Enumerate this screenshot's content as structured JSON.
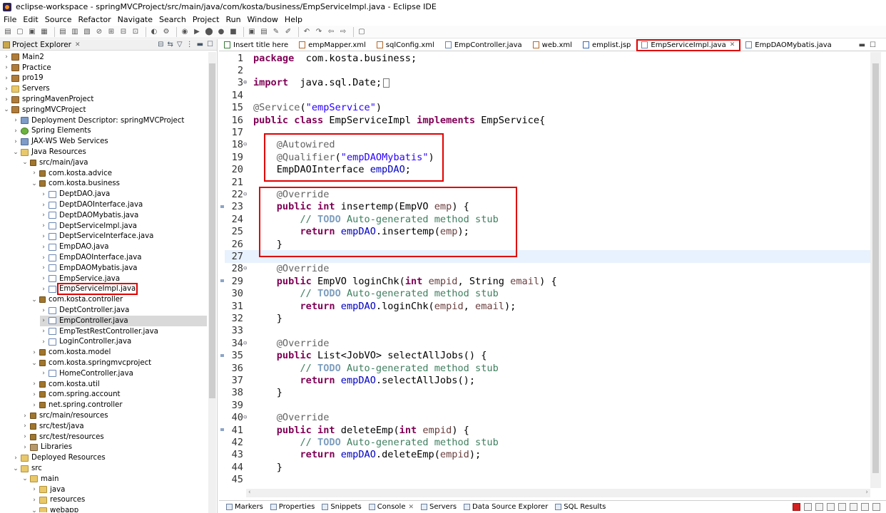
{
  "window": {
    "title": "eclipse-workspace - springMVCProject/src/main/java/com/kosta/business/EmpServiceImpl.java - Eclipse IDE"
  },
  "menu": [
    "File",
    "Edit",
    "Source",
    "Refactor",
    "Navigate",
    "Search",
    "Project",
    "Run",
    "Window",
    "Help"
  ],
  "project_explorer": {
    "title": "Project Explorer",
    "items": [
      {
        "label": "Main2",
        "depth": 0,
        "chevron": ">",
        "icon": "project"
      },
      {
        "label": "Practice",
        "depth": 0,
        "chevron": ">",
        "icon": "project"
      },
      {
        "label": "pro19",
        "depth": 0,
        "chevron": ">",
        "icon": "project"
      },
      {
        "label": "Servers",
        "depth": 0,
        "chevron": ">",
        "icon": "folder"
      },
      {
        "label": "springMavenProject",
        "depth": 0,
        "chevron": ">",
        "icon": "project"
      },
      {
        "label": "springMVCProject",
        "depth": 0,
        "chevron": "v",
        "icon": "project"
      },
      {
        "label": "Deployment Descriptor: springMVCProject",
        "depth": 1,
        "chevron": ">",
        "icon": "descriptor"
      },
      {
        "label": "Spring Elements",
        "depth": 1,
        "chevron": ">",
        "icon": "spring"
      },
      {
        "label": "JAX-WS Web Services",
        "depth": 1,
        "chevron": ">",
        "icon": "descriptor"
      },
      {
        "label": "Java Resources",
        "depth": 1,
        "chevron": "v",
        "icon": "folder"
      },
      {
        "label": "src/main/java",
        "depth": 2,
        "chevron": "v",
        "icon": "package"
      },
      {
        "label": "com.kosta.advice",
        "depth": 3,
        "chevron": ">",
        "icon": "package"
      },
      {
        "label": "com.kosta.business",
        "depth": 3,
        "chevron": "v",
        "icon": "package"
      },
      {
        "label": "DeptDAO.java",
        "depth": 4,
        "chevron": ">",
        "icon": "java"
      },
      {
        "label": "DeptDAOInterface.java",
        "depth": 4,
        "chevron": ">",
        "icon": "java"
      },
      {
        "label": "DeptDAOMybatis.java",
        "depth": 4,
        "chevron": ">",
        "icon": "java"
      },
      {
        "label": "DeptServiceImpl.java",
        "depth": 4,
        "chevron": ">",
        "icon": "java"
      },
      {
        "label": "DeptServiceInterface.java",
        "depth": 4,
        "chevron": ">",
        "icon": "java"
      },
      {
        "label": "EmpDAO.java",
        "depth": 4,
        "chevron": ">",
        "icon": "java"
      },
      {
        "label": "EmpDAOInterface.java",
        "depth": 4,
        "chevron": ">",
        "icon": "java"
      },
      {
        "label": "EmpDAOMybatis.java",
        "depth": 4,
        "chevron": ">",
        "icon": "java"
      },
      {
        "label": "EmpService.java",
        "depth": 4,
        "chevron": ">",
        "icon": "java"
      },
      {
        "label": "EmpServiceImpl.java",
        "depth": 4,
        "chevron": ">",
        "icon": "java",
        "boxed": true
      },
      {
        "label": "com.kosta.controller",
        "depth": 3,
        "chevron": "v",
        "icon": "package"
      },
      {
        "label": "DeptController.java",
        "depth": 4,
        "chevron": ">",
        "icon": "java"
      },
      {
        "label": "EmpController.java",
        "depth": 4,
        "chevron": ">",
        "icon": "java",
        "selected": true
      },
      {
        "label": "EmpTestRestController.java",
        "depth": 4,
        "chevron": ">",
        "icon": "java"
      },
      {
        "label": "LoginController.java",
        "depth": 4,
        "chevron": ">",
        "icon": "java"
      },
      {
        "label": "com.kosta.model",
        "depth": 3,
        "chevron": ">",
        "icon": "package"
      },
      {
        "label": "com.kosta.springmvcproject",
        "depth": 3,
        "chevron": "v",
        "icon": "package"
      },
      {
        "label": "HomeController.java",
        "depth": 4,
        "chevron": ">",
        "icon": "java"
      },
      {
        "label": "com.kosta.util",
        "depth": 3,
        "chevron": ">",
        "icon": "package"
      },
      {
        "label": "com.spring.account",
        "depth": 3,
        "chevron": ">",
        "icon": "package"
      },
      {
        "label": "net.spring.controller",
        "depth": 3,
        "chevron": ">",
        "icon": "package"
      },
      {
        "label": "src/main/resources",
        "depth": 2,
        "chevron": ">",
        "icon": "package"
      },
      {
        "label": "src/test/java",
        "depth": 2,
        "chevron": ">",
        "icon": "package"
      },
      {
        "label": "src/test/resources",
        "depth": 2,
        "chevron": ">",
        "icon": "package"
      },
      {
        "label": "Libraries",
        "depth": 2,
        "chevron": ">",
        "icon": "library"
      },
      {
        "label": "Deployed Resources",
        "depth": 1,
        "chevron": ">",
        "icon": "folder"
      },
      {
        "label": "src",
        "depth": 1,
        "chevron": "v",
        "icon": "folder"
      },
      {
        "label": "main",
        "depth": 2,
        "chevron": "v",
        "icon": "folder"
      },
      {
        "label": "java",
        "depth": 3,
        "chevron": ">",
        "icon": "folder"
      },
      {
        "label": "resources",
        "depth": 3,
        "chevron": ">",
        "icon": "folder"
      },
      {
        "label": "webapp",
        "depth": 3,
        "chevron": "v",
        "icon": "folder"
      }
    ]
  },
  "editor_tabs": [
    {
      "label": "Insert title here",
      "icon": "html"
    },
    {
      "label": "empMapper.xml",
      "icon": "xml"
    },
    {
      "label": "sqlConfig.xml",
      "icon": "xml"
    },
    {
      "label": "EmpController.java",
      "icon": "java"
    },
    {
      "label": "web.xml",
      "icon": "xml"
    },
    {
      "label": "emplist.jsp",
      "icon": "jsp"
    },
    {
      "label": "EmpServiceImpl.java",
      "icon": "java",
      "active": true
    },
    {
      "label": "EmpDAOMybatis.java",
      "icon": "java"
    }
  ],
  "code_lines": [
    {
      "n": "1",
      "fold": "",
      "tokens": [
        [
          "kw",
          "package"
        ],
        [
          "",
          "  com.kosta.business;"
        ]
      ]
    },
    {
      "n": "2",
      "fold": "",
      "tokens": []
    },
    {
      "n": "3",
      "fold": "+",
      "tokens": [
        [
          "kw",
          "import"
        ],
        [
          "",
          "  java.sql.Date;"
        ]
      ],
      "collapsed": true
    },
    {
      "n": "14",
      "fold": "",
      "tokens": []
    },
    {
      "n": "15",
      "fold": "",
      "tokens": [
        [
          "ann",
          "@Service"
        ],
        [
          "",
          "("
        ],
        [
          "str",
          "\"empService\""
        ],
        [
          "",
          ")"
        ]
      ]
    },
    {
      "n": "16",
      "fold": "",
      "tokens": [
        [
          "kw",
          "public"
        ],
        [
          "",
          " "
        ],
        [
          "kw",
          "class"
        ],
        [
          "",
          " EmpServiceImpl "
        ],
        [
          "kw",
          "implements"
        ],
        [
          "",
          " EmpService{"
        ]
      ]
    },
    {
      "n": "17",
      "fold": "",
      "tokens": []
    },
    {
      "n": "18",
      "fold": "-",
      "tokens": [
        [
          "",
          "    "
        ],
        [
          "ann",
          "@Autowired"
        ]
      ]
    },
    {
      "n": "19",
      "fold": "",
      "tokens": [
        [
          "",
          "    "
        ],
        [
          "ann",
          "@Qualifier"
        ],
        [
          "",
          "("
        ],
        [
          "str",
          "\"empDAOMybatis\""
        ],
        [
          "",
          ")"
        ]
      ]
    },
    {
      "n": "20",
      "fold": "",
      "tokens": [
        [
          "",
          "    EmpDAOInterface "
        ],
        [
          "fld",
          "empDAO"
        ],
        [
          "",
          ";"
        ]
      ]
    },
    {
      "n": "21",
      "fold": "",
      "tokens": []
    },
    {
      "n": "22",
      "fold": "-",
      "tokens": [
        [
          "",
          "    "
        ],
        [
          "ann",
          "@Override"
        ]
      ]
    },
    {
      "n": "23",
      "fold": "",
      "tokens": [
        [
          "",
          "    "
        ],
        [
          "kw",
          "public"
        ],
        [
          "",
          " "
        ],
        [
          "kw",
          "int"
        ],
        [
          "",
          " insertemp(EmpVO "
        ],
        [
          "prm",
          "emp"
        ],
        [
          "",
          ") {"
        ]
      ]
    },
    {
      "n": "24",
      "fold": "",
      "tokens": [
        [
          "",
          "        "
        ],
        [
          "cmt",
          "// "
        ],
        [
          "todo",
          "TODO"
        ],
        [
          "cmt",
          " Auto-generated method stub"
        ]
      ]
    },
    {
      "n": "25",
      "fold": "",
      "tokens": [
        [
          "",
          "        "
        ],
        [
          "kw",
          "return"
        ],
        [
          "",
          " "
        ],
        [
          "fld",
          "empDAO"
        ],
        [
          "",
          ".insertemp("
        ],
        [
          "prm",
          "emp"
        ],
        [
          "",
          ");"
        ]
      ]
    },
    {
      "n": "26",
      "fold": "",
      "tokens": [
        [
          "",
          "    }"
        ]
      ]
    },
    {
      "n": "27",
      "fold": "",
      "tokens": [],
      "current": true
    },
    {
      "n": "28",
      "fold": "-",
      "tokens": [
        [
          "",
          "    "
        ],
        [
          "ann",
          "@Override"
        ]
      ]
    },
    {
      "n": "29",
      "fold": "",
      "tokens": [
        [
          "",
          "    "
        ],
        [
          "kw",
          "public"
        ],
        [
          "",
          " EmpVO loginChk("
        ],
        [
          "kw",
          "int"
        ],
        [
          "",
          " "
        ],
        [
          "prm",
          "empid"
        ],
        [
          "",
          ", String "
        ],
        [
          "prm",
          "email"
        ],
        [
          "",
          ") {"
        ]
      ]
    },
    {
      "n": "30",
      "fold": "",
      "tokens": [
        [
          "",
          "        "
        ],
        [
          "cmt",
          "// "
        ],
        [
          "todo",
          "TODO"
        ],
        [
          "cmt",
          " Auto-generated method stub"
        ]
      ]
    },
    {
      "n": "31",
      "fold": "",
      "tokens": [
        [
          "",
          "        "
        ],
        [
          "kw",
          "return"
        ],
        [
          "",
          " "
        ],
        [
          "fld",
          "empDAO"
        ],
        [
          "",
          ".loginChk("
        ],
        [
          "prm",
          "empid"
        ],
        [
          "",
          ", "
        ],
        [
          "prm",
          "email"
        ],
        [
          "",
          ");"
        ]
      ]
    },
    {
      "n": "32",
      "fold": "",
      "tokens": [
        [
          "",
          "    }"
        ]
      ]
    },
    {
      "n": "33",
      "fold": "",
      "tokens": []
    },
    {
      "n": "34",
      "fold": "-",
      "tokens": [
        [
          "",
          "    "
        ],
        [
          "ann",
          "@Override"
        ]
      ]
    },
    {
      "n": "35",
      "fold": "",
      "tokens": [
        [
          "",
          "    "
        ],
        [
          "kw",
          "public"
        ],
        [
          "",
          " List<JobVO> selectAllJobs() {"
        ]
      ]
    },
    {
      "n": "36",
      "fold": "",
      "tokens": [
        [
          "",
          "        "
        ],
        [
          "cmt",
          "// "
        ],
        [
          "todo",
          "TODO"
        ],
        [
          "cmt",
          " Auto-generated method stub"
        ]
      ]
    },
    {
      "n": "37",
      "fold": "",
      "tokens": [
        [
          "",
          "        "
        ],
        [
          "kw",
          "return"
        ],
        [
          "",
          " "
        ],
        [
          "fld",
          "empDAO"
        ],
        [
          "",
          ".selectAllJobs();"
        ]
      ]
    },
    {
      "n": "38",
      "fold": "",
      "tokens": [
        [
          "",
          "    }"
        ]
      ]
    },
    {
      "n": "39",
      "fold": "",
      "tokens": []
    },
    {
      "n": "40",
      "fold": "-",
      "tokens": [
        [
          "",
          "    "
        ],
        [
          "ann",
          "@Override"
        ]
      ]
    },
    {
      "n": "41",
      "fold": "",
      "tokens": [
        [
          "",
          "    "
        ],
        [
          "kw",
          "public"
        ],
        [
          "",
          " "
        ],
        [
          "kw",
          "int"
        ],
        [
          "",
          " deleteEmp("
        ],
        [
          "kw",
          "int"
        ],
        [
          "",
          " "
        ],
        [
          "prm",
          "empid"
        ],
        [
          "",
          ") {"
        ]
      ]
    },
    {
      "n": "42",
      "fold": "",
      "tokens": [
        [
          "",
          "        "
        ],
        [
          "cmt",
          "// "
        ],
        [
          "todo",
          "TODO"
        ],
        [
          "cmt",
          " Auto-generated method stub"
        ]
      ]
    },
    {
      "n": "43",
      "fold": "",
      "tokens": [
        [
          "",
          "        "
        ],
        [
          "kw",
          "return"
        ],
        [
          "",
          " "
        ],
        [
          "fld",
          "empDAO"
        ],
        [
          "",
          ".deleteEmp("
        ],
        [
          "prm",
          "empid"
        ],
        [
          "",
          ");"
        ]
      ]
    },
    {
      "n": "44",
      "fold": "",
      "tokens": [
        [
          "",
          "    }"
        ]
      ]
    },
    {
      "n": "45",
      "fold": "",
      "tokens": []
    }
  ],
  "bottom_tabs": [
    {
      "label": "Markers"
    },
    {
      "label": "Properties"
    },
    {
      "label": "Snippets"
    },
    {
      "label": "Console",
      "closable": true
    },
    {
      "label": "Servers"
    },
    {
      "label": "Data Source Explorer"
    },
    {
      "label": "SQL Results"
    }
  ],
  "colors": {
    "highlight": "#e00000",
    "keyword": "#7f0055",
    "string": "#2a00ff",
    "comment": "#3f7f5f",
    "field": "#0000c0"
  }
}
